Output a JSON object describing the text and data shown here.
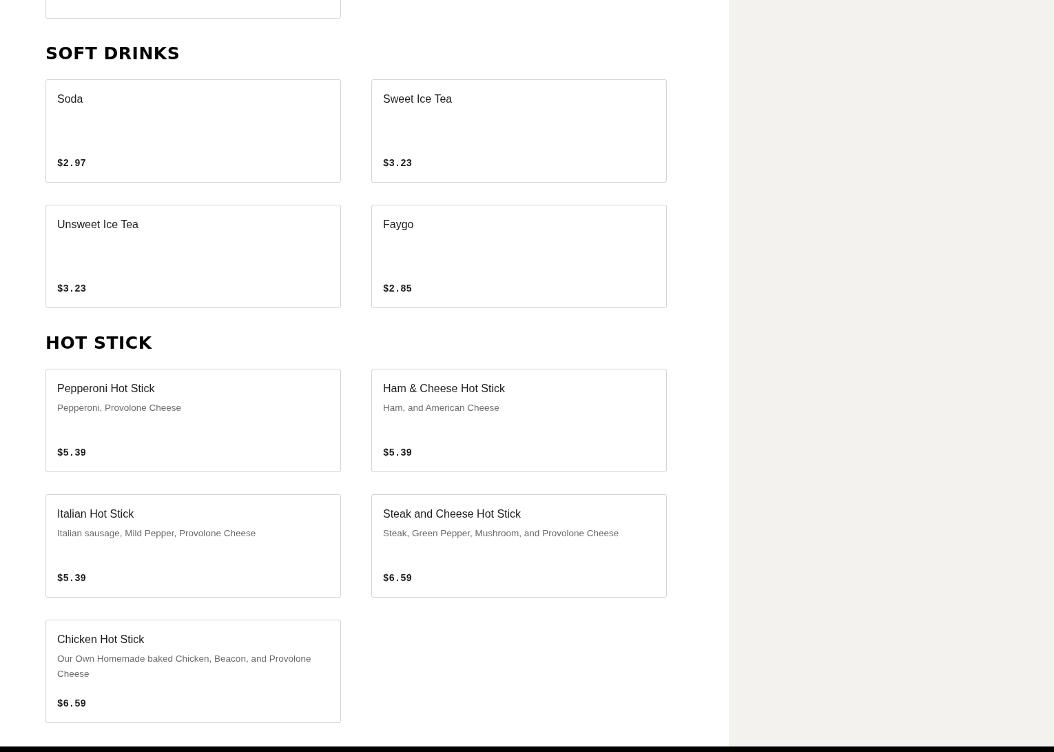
{
  "sections": [
    {
      "title": "SOFT DRINKS",
      "items": [
        {
          "name": "Soda",
          "price": "$2.97"
        },
        {
          "name": "Sweet Ice Tea",
          "price": "$3.23"
        },
        {
          "name": "Unsweet Ice Tea",
          "price": "$3.23"
        },
        {
          "name": "Faygo",
          "price": "$2.85"
        }
      ]
    },
    {
      "title": "HOT STICK",
      "items": [
        {
          "name": "Pepperoni Hot Stick",
          "description": "Pepperoni, Provolone Cheese",
          "price": "$5.39"
        },
        {
          "name": "Ham & Cheese Hot Stick",
          "description": "Ham, and American Cheese",
          "price": "$5.39"
        },
        {
          "name": "Italian Hot Stick",
          "description": "Italian sausage, Mild Pepper, Provolone Cheese",
          "price": "$5.39"
        },
        {
          "name": "Steak and Cheese Hot Stick",
          "description": "Steak, Green Pepper, Mushroom, and Provolone Cheese",
          "price": "$6.59"
        },
        {
          "name": "Chicken Hot Stick",
          "description": "Our Own Homemade baked Chicken, Beacon, and Provolone Cheese",
          "price": "$6.59"
        }
      ]
    }
  ]
}
